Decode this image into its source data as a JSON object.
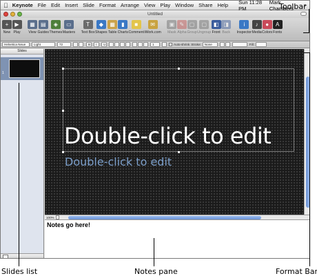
{
  "menubar": {
    "apple": "",
    "items": [
      "Keynote",
      "File",
      "Edit",
      "Insert",
      "Slide",
      "Format",
      "Arrange",
      "View",
      "Play",
      "Window",
      "Share",
      "Help"
    ],
    "clock": "Sun 11:28 PM",
    "user": "Mark Chambers",
    "spotlight": "⌕"
  },
  "window": {
    "title": "Untitled"
  },
  "toolbar": {
    "items": [
      {
        "label": "New",
        "icon": "plus-icon",
        "color": "#555555",
        "dim": false
      },
      {
        "label": "Play",
        "icon": "play-icon",
        "color": "#555555",
        "dim": false
      },
      {
        "label": "View",
        "icon": "view-icon",
        "color": "#5a6e8c",
        "dim": false
      },
      {
        "label": "Guides",
        "icon": "guides-icon",
        "color": "#5a6e8c",
        "dim": false
      },
      {
        "label": "Themes",
        "icon": "themes-icon",
        "color": "#4d7f3a",
        "dim": false
      },
      {
        "label": "Masters",
        "icon": "masters-icon",
        "color": "#5a6e8c",
        "dim": false
      },
      {
        "label": "Text Box",
        "icon": "textbox-icon",
        "color": "#6b6b6b",
        "dim": false
      },
      {
        "label": "Shapes",
        "icon": "shapes-icon",
        "color": "#3a78c5",
        "dim": false
      },
      {
        "label": "Table",
        "icon": "table-icon",
        "color": "#caa24a",
        "dim": false
      },
      {
        "label": "Charts",
        "icon": "charts-icon",
        "color": "#3a78c5",
        "dim": false
      },
      {
        "label": "Comment",
        "icon": "comment-icon",
        "color": "#e3c54b",
        "dim": false
      },
      {
        "label": "iWork.com",
        "icon": "iwork-icon",
        "color": "#c9a340",
        "dim": false
      },
      {
        "label": "Mask",
        "icon": "mask-icon",
        "color": "#6b6b6b",
        "dim": true
      },
      {
        "label": "Alpha",
        "icon": "alpha-icon",
        "color": "#c0504d",
        "dim": true
      },
      {
        "label": "Group",
        "icon": "group-icon",
        "color": "#6b6b6b",
        "dim": true
      },
      {
        "label": "Ungroup",
        "icon": "ungroup-icon",
        "color": "#6b6b6b",
        "dim": true
      },
      {
        "label": "Front",
        "icon": "front-icon",
        "color": "#3a5c9c",
        "dim": false
      },
      {
        "label": "Back",
        "icon": "back-icon",
        "color": "#3a5c9c",
        "dim": true
      },
      {
        "label": "Inspector",
        "icon": "inspector-icon",
        "color": "#3a78c5",
        "dim": false
      },
      {
        "label": "Media",
        "icon": "media-icon",
        "color": "#444444",
        "dim": false
      },
      {
        "label": "Colors",
        "icon": "colors-icon",
        "color": "#c94a5a",
        "dim": false
      },
      {
        "label": "Fonts",
        "icon": "fonts-icon",
        "color": "#222222",
        "dim": false
      }
    ]
  },
  "formatbar": {
    "font": "Helvetica Neue",
    "style": "Light",
    "size": "72",
    "alignment_labels": [
      "B",
      "I",
      "U"
    ],
    "spacing": "1",
    "autoshrink": "Auto-shrink",
    "stroke_label": "Stroke:",
    "stroke_value": "None",
    "fill_label": "Fill:"
  },
  "slides_pane": {
    "header": "Slides",
    "slide_number": "1"
  },
  "slide": {
    "title": "Double-click to edit",
    "subtitle": "Double-click to edit"
  },
  "statusbar": {
    "zoom": "100%"
  },
  "notes": {
    "text": "Notes go here!"
  },
  "callouts": {
    "toolbar": "Toolbar",
    "slides_list": "Slides list",
    "notes_pane": "Notes pane",
    "format_bar": "Format Bar"
  },
  "colors": {
    "subtitle": "#7b9ec9",
    "selected_thumbnail_row": "#7f93b3",
    "scroll_thumb": "#6b93d6"
  }
}
